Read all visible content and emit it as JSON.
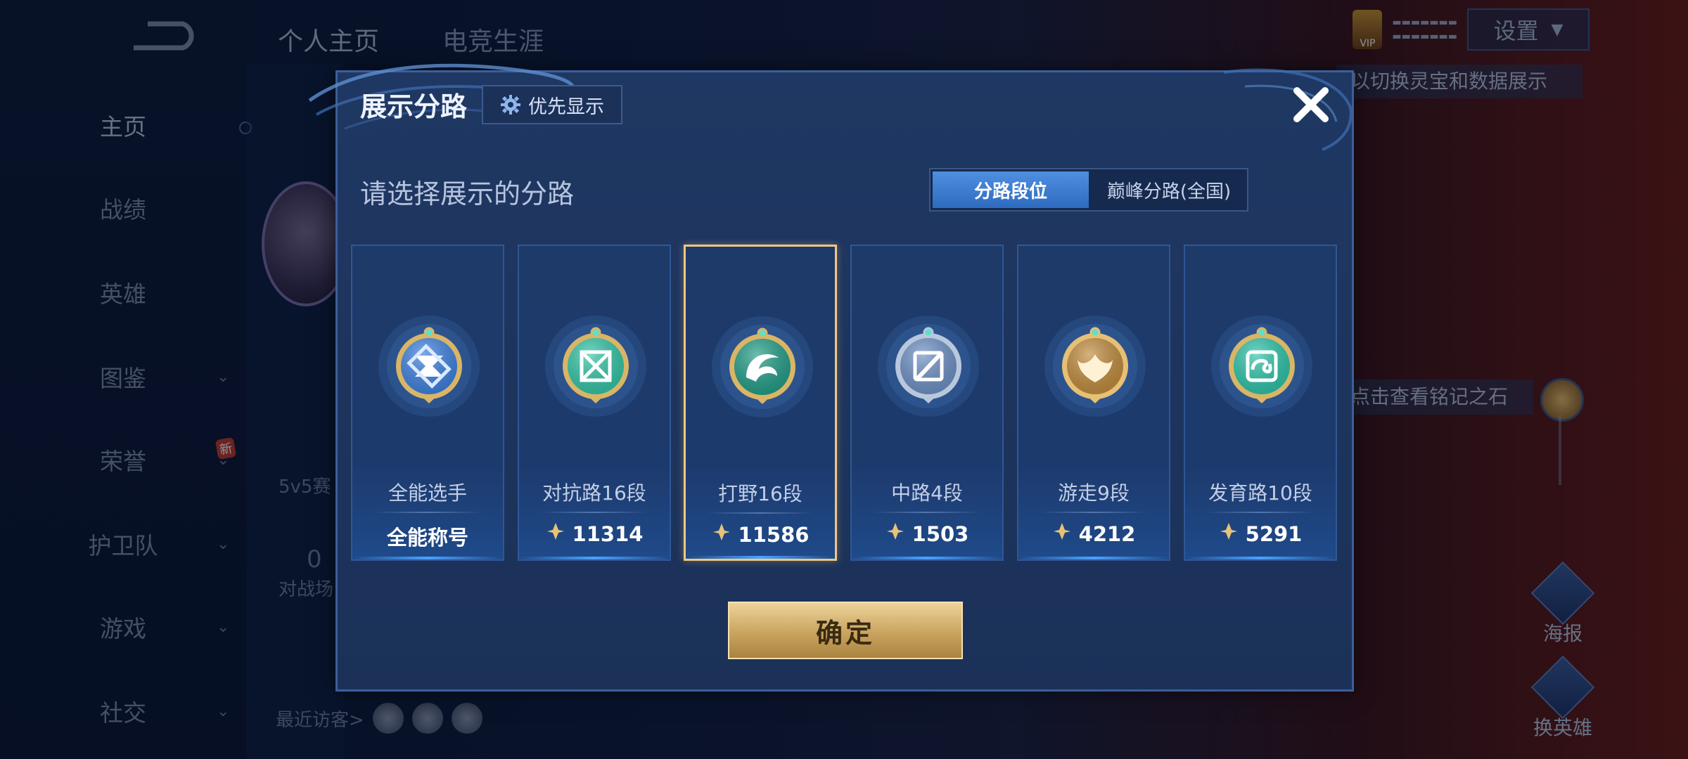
{
  "background": {
    "top_tabs": [
      "个人主页",
      "电竞生涯"
    ],
    "nav_items": [
      {
        "label": "主页",
        "active": true,
        "has_chevron": false
      },
      {
        "label": "战绩",
        "active": false,
        "has_chevron": false
      },
      {
        "label": "英雄",
        "active": false,
        "has_chevron": false
      },
      {
        "label": "图鉴",
        "active": false,
        "has_chevron": true
      },
      {
        "label": "荣誉",
        "active": false,
        "has_chevron": true,
        "badge": "新"
      },
      {
        "label": "护卫队",
        "active": false,
        "has_chevron": true
      },
      {
        "label": "游戏",
        "active": false,
        "has_chevron": true
      },
      {
        "label": "社交",
        "active": false,
        "has_chevron": true
      }
    ],
    "mode_label": "5v5赛",
    "battle_count": "0",
    "battle_label": "对战场",
    "recent_visitors_label": "最近访客>",
    "vip_label": "VIP",
    "settings_label": "设置",
    "hint_text": "以切换灵宝和数据展示",
    "hint_text2": "点击查看铭记之石",
    "side_tools": [
      "海报",
      "换英雄"
    ]
  },
  "modal": {
    "title": "展示分路",
    "priority_label": "优先显示",
    "subtitle": "请选择展示的分路",
    "segments": [
      {
        "label": "分路段位",
        "active": true
      },
      {
        "label": "巅峰分路(全国)",
        "active": false
      }
    ],
    "lanes": [
      {
        "name": "全能选手",
        "value": "全能称号",
        "show_points_icon": false,
        "selected": false,
        "emblem": "allround",
        "colors": [
          "#3a7fe0",
          "#d9b566"
        ]
      },
      {
        "name": "对抗路16段",
        "value": "11314",
        "show_points_icon": true,
        "selected": false,
        "emblem": "clash",
        "colors": [
          "#2fc4a5",
          "#d9b566"
        ]
      },
      {
        "name": "打野16段",
        "value": "11586",
        "show_points_icon": true,
        "selected": true,
        "emblem": "jungle",
        "colors": [
          "#1f9c86",
          "#d9b566"
        ]
      },
      {
        "name": "中路4段",
        "value": "1503",
        "show_points_icon": true,
        "selected": false,
        "emblem": "mid",
        "colors": [
          "#6b8fc4",
          "#b9c7dd"
        ]
      },
      {
        "name": "游走9段",
        "value": "4212",
        "show_points_icon": true,
        "selected": false,
        "emblem": "roam",
        "colors": [
          "#c08a3a",
          "#e6c074"
        ]
      },
      {
        "name": "发育路10段",
        "value": "5291",
        "show_points_icon": true,
        "selected": false,
        "emblem": "farm",
        "colors": [
          "#29c3a8",
          "#d9b566"
        ]
      }
    ],
    "confirm_label": "确定"
  }
}
